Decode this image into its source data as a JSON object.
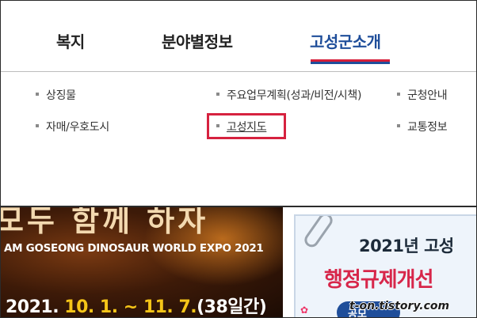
{
  "nav": {
    "tabs": [
      {
        "label": "복지"
      },
      {
        "label": "분야별정보"
      },
      {
        "label": "고성군소개",
        "active": true
      }
    ]
  },
  "submenu": {
    "items": [
      {
        "label": "상징물"
      },
      {
        "label": "주요업무계획(성과/비전/시책)"
      },
      {
        "label": "군청안내"
      },
      {
        "label": "자매/우호도시"
      },
      {
        "label": "고성지도",
        "highlighted": true
      },
      {
        "label": "교통정보"
      }
    ]
  },
  "banner_left": {
    "top_text": "모두 함께 하자",
    "expo_title": "AM GOSEONG DINOSAUR WORLD EXPO 2021",
    "date_prefix": "2021.",
    "date_range": "10. 1. ~ 11. 7.",
    "date_suffix": "(38일간)"
  },
  "banner_right": {
    "year_title": "2021년 고성",
    "main_title": "행정규제개선",
    "button_label": "공모",
    "deco": "✿"
  },
  "watermark": "t-on.tistory.com",
  "colors": {
    "active_tab": "#1f4e9a",
    "underline_red": "#d61f3a",
    "highlight_border": "#d6223f"
  }
}
